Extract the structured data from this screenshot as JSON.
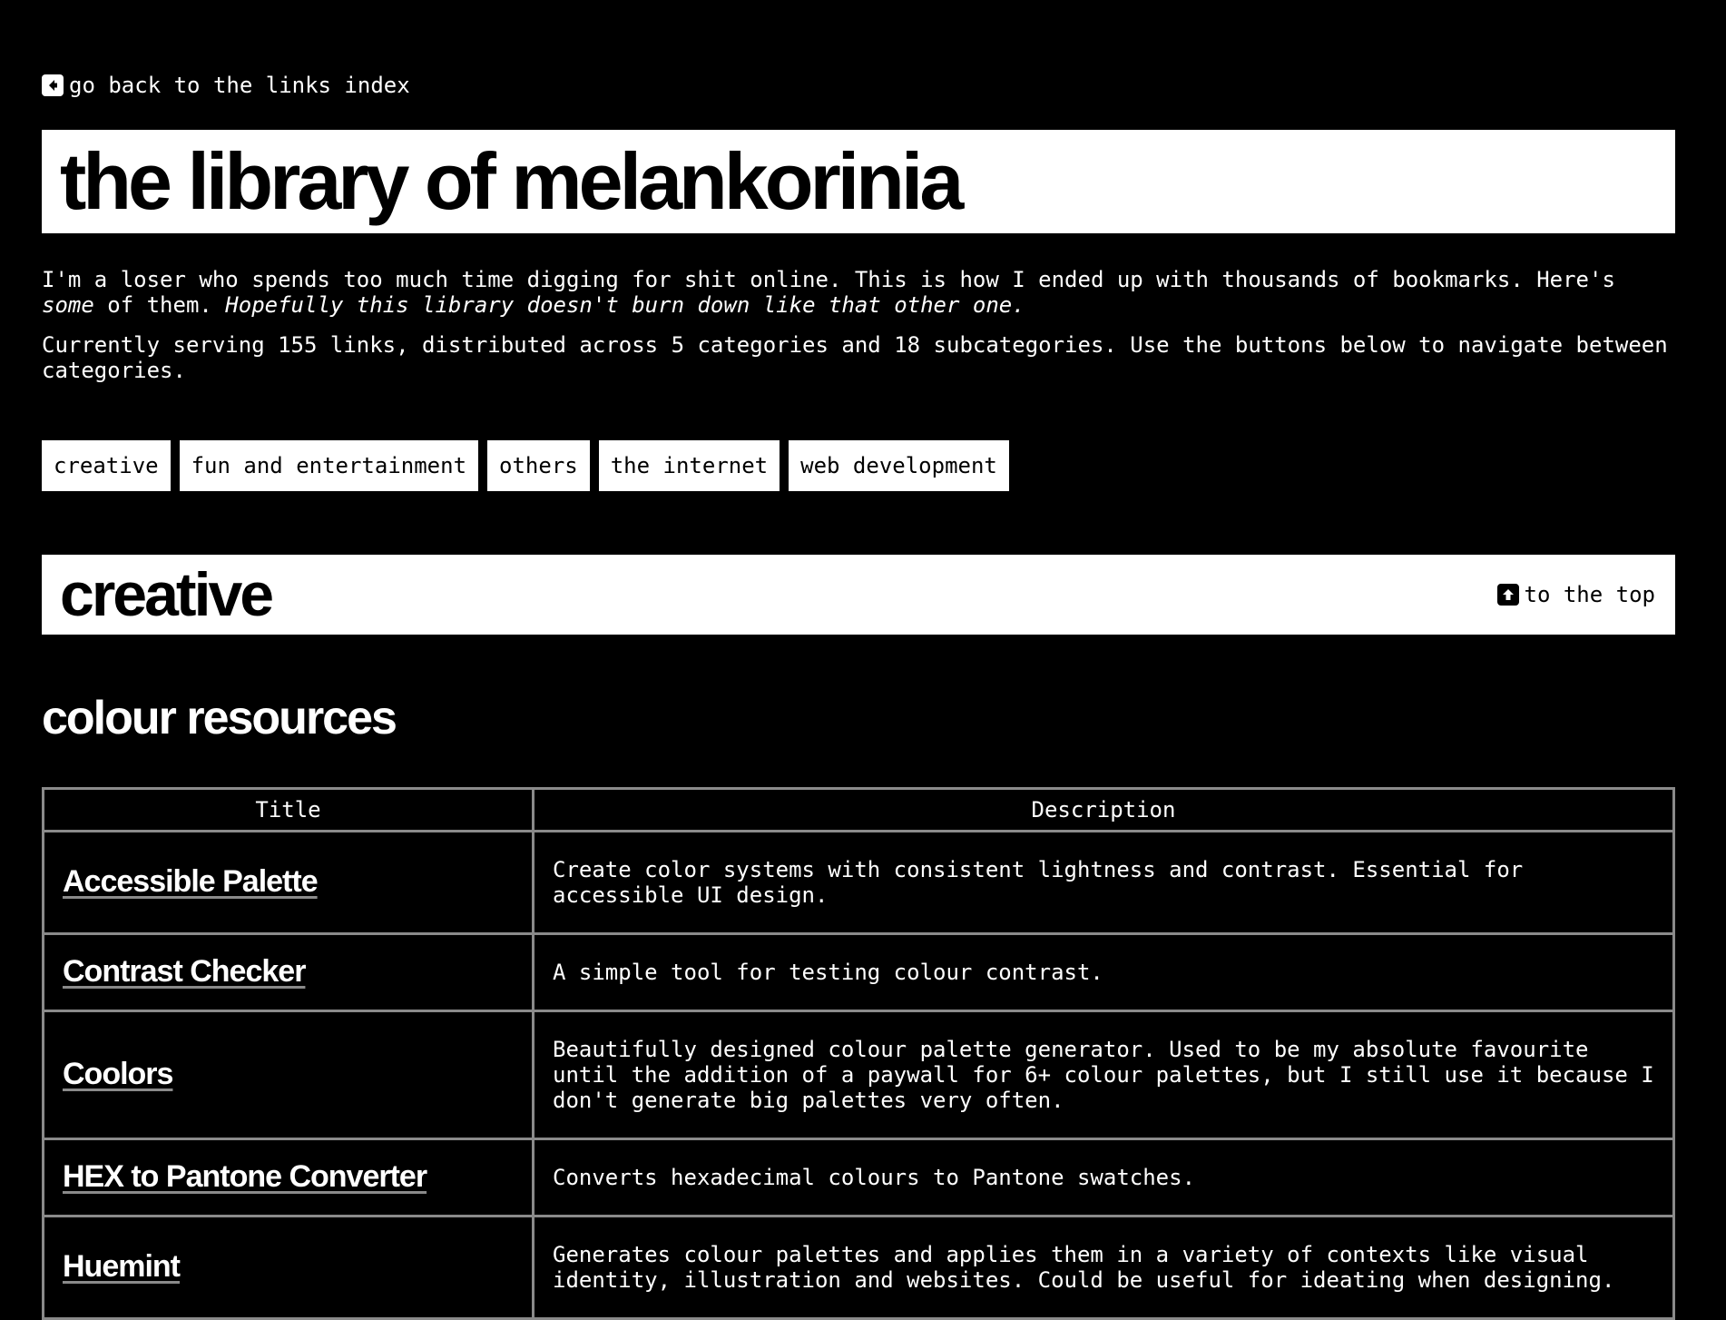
{
  "back_link": {
    "label": "go back to the links index"
  },
  "page_title": "the library of melankorinia",
  "intro": {
    "p1_part1": "I'm a loser who spends too much time digging for shit online. This is how I ended up with thousands of bookmarks. Here's ",
    "p1_em1": "some",
    "p1_part2": " of them. ",
    "p1_em2": "Hopefully this library doesn't burn down like that other one.",
    "p2": "Currently serving 155 links, distributed across 5 categories and 18 subcategories. Use the buttons below to navigate between categories."
  },
  "categories": [
    {
      "label": "creative"
    },
    {
      "label": "fun and entertainment"
    },
    {
      "label": "others"
    },
    {
      "label": "the internet"
    },
    {
      "label": "web development"
    }
  ],
  "section": {
    "title": "creative",
    "top_link": "to the top"
  },
  "subcategory": {
    "title": "colour resources",
    "columns": [
      "Title",
      "Description"
    ],
    "rows": [
      {
        "title": "Accessible Palette",
        "description": "Create color systems with consistent lightness and contrast. Essential for accessible UI design."
      },
      {
        "title": "Contrast Checker",
        "description": "A simple tool for testing colour contrast."
      },
      {
        "title": "Coolors",
        "description": "Beautifully designed colour palette generator. Used to be my absolute favourite until the addition of a paywall for 6+ colour palettes, but I still use it because I don't generate big palettes very often."
      },
      {
        "title": "HEX to Pantone Converter",
        "description": "Converts hexadecimal colours to Pantone swatches."
      },
      {
        "title": "Huemint",
        "description": "Generates colour palettes and applies them in a variety of contexts like visual identity, illustration and websites. Could be useful for ideating when designing."
      }
    ]
  },
  "colors": {
    "background": "#000000",
    "foreground": "#ffffff",
    "table_border": "#8a8a8a"
  },
  "icons": {
    "back": "arrow-left-square-icon",
    "top": "arrow-up-square-icon"
  }
}
